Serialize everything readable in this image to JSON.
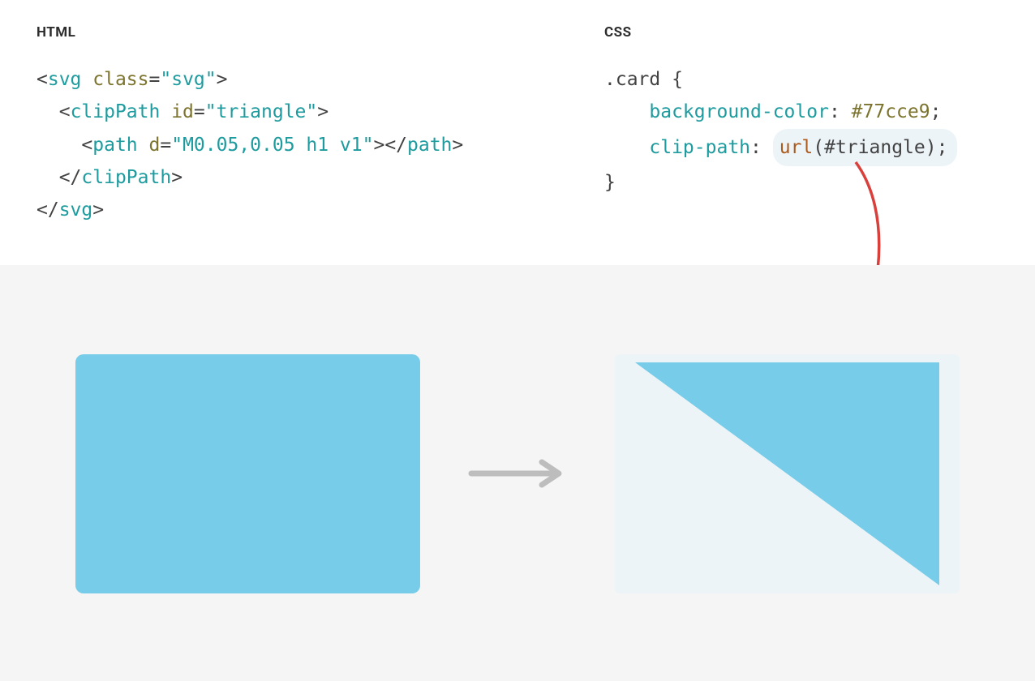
{
  "labels": {
    "html": "HTML",
    "css": "CSS"
  },
  "html_code": {
    "line1": {
      "open": "<",
      "tag": "svg",
      "attr": "class",
      "eq": "=",
      "val": "\"svg\"",
      "close": ">"
    },
    "line2": {
      "indent": "  ",
      "open": "<",
      "tag": "clipPath",
      "attr": "id",
      "eq": "=",
      "val": "\"triangle\"",
      "close": ">"
    },
    "line3": {
      "indent": "    ",
      "open": "<",
      "tag": "path",
      "attr": "d",
      "eq": "=",
      "val": "\"M0.05,0.05 h1 v1\"",
      "close": "></",
      "closetag": "path",
      "closeend": ">"
    },
    "line4": {
      "indent": "  ",
      "open": "</",
      "tag": "clipPath",
      "close": ">"
    },
    "line5": {
      "open": "</",
      "tag": "svg",
      "close": ">"
    }
  },
  "css_code": {
    "line1": {
      "selector": ".card",
      "brace": " {"
    },
    "line2": {
      "indent": "    ",
      "prop": "background-color",
      "colon": ": ",
      "value": "#77cce9",
      "semi": ";"
    },
    "line3": {
      "indent": "    ",
      "prop": "clip-path",
      "colon": ": ",
      "func": "url",
      "args": "(#triangle);"
    },
    "line4": {
      "brace": "}"
    }
  },
  "colors": {
    "card_bg": "#77cce9",
    "page_bg_bottom": "#f5f5f5",
    "clip_wrap_bg": "#ecf4f8",
    "arrow_red": "#d9403b",
    "arrow_gray": "#bdbdbd"
  }
}
